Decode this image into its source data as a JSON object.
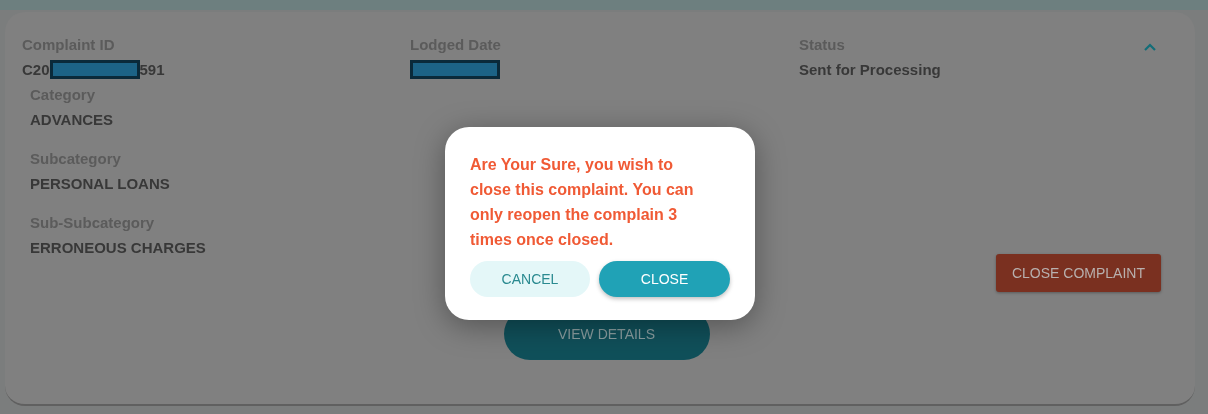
{
  "complaint_card": {
    "expanded": true,
    "header": [
      {
        "kind": "id",
        "label": "Complaint ID",
        "value_start": "C20",
        "value_end": "591",
        "redacted": true
      },
      {
        "kind": "date",
        "label": "Lodged Date",
        "redacted": true
      },
      {
        "kind": "text",
        "label": "Status",
        "value": "Sent for Processing"
      }
    ],
    "details": [
      {
        "label": "Category",
        "value": "ADVANCES"
      },
      {
        "label": "Subcategory",
        "value": "PERSONAL LOANS"
      },
      {
        "label": "Sub-Subcategory",
        "value": "ERRONEOUS CHARGES"
      }
    ],
    "close_button": "CLOSE COMPLAINT",
    "view_button": "VIEW DETAILS"
  },
  "dialog": {
    "message": "Are Your Sure, you wish to close this complaint. You can only reopen the complain 3 times once closed.",
    "buttons": [
      {
        "label": "CANCEL",
        "kind": "secondary"
      },
      {
        "label": "CLOSE",
        "kind": "primary"
      }
    ]
  }
}
